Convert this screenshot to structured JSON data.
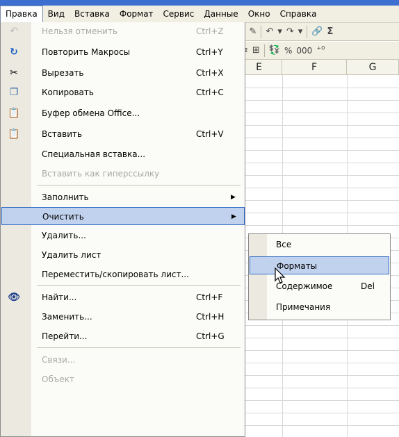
{
  "menubar": {
    "items": [
      {
        "label": "Правка"
      },
      {
        "label": "Вид"
      },
      {
        "label": "Вставка"
      },
      {
        "label": "Формат"
      },
      {
        "label": "Сервис"
      },
      {
        "label": "Данные"
      },
      {
        "label": "Окно"
      },
      {
        "label": "Справка"
      }
    ],
    "active": "Правка"
  },
  "toolbar": {
    "row1": {
      "sigma": "Σ"
    },
    "row2": {
      "percent": "%",
      "thousands": "000"
    }
  },
  "grid": {
    "columns": [
      "E",
      "F",
      "G"
    ]
  },
  "edit_menu": {
    "items": [
      {
        "id": "undo",
        "label": "Нельзя отменить",
        "shortcut": "Ctrl+Z",
        "disabled": true,
        "icon": "undo-icon"
      },
      {
        "id": "redo",
        "label": "Повторить Макросы",
        "shortcut": "Ctrl+Y",
        "disabled": false,
        "icon": "redo-icon"
      },
      {
        "id": "cut",
        "label": "Вырезать",
        "shortcut": "Ctrl+X",
        "disabled": false,
        "icon": "scissors-icon"
      },
      {
        "id": "copy",
        "label": "Копировать",
        "shortcut": "Ctrl+C",
        "disabled": false,
        "icon": "copy-icon"
      },
      {
        "id": "clipboard",
        "label": "Буфер обмена Office...",
        "shortcut": "",
        "disabled": false,
        "icon": "clipboard-icon"
      },
      {
        "id": "paste",
        "label": "Вставить",
        "shortcut": "Ctrl+V",
        "disabled": false,
        "icon": "paste-icon"
      },
      {
        "id": "paste-special",
        "label": "Специальная вставка...",
        "shortcut": "",
        "disabled": false,
        "icon": ""
      },
      {
        "id": "paste-hyperlink",
        "label": "Вставить как гиперссылку",
        "shortcut": "",
        "disabled": true,
        "icon": ""
      },
      {
        "id": "fill",
        "label": "Заполнить",
        "shortcut": "",
        "disabled": false,
        "icon": "",
        "submenu": true
      },
      {
        "id": "clear",
        "label": "Очистить",
        "shortcut": "",
        "disabled": false,
        "icon": "",
        "submenu": true,
        "highlighted": true
      },
      {
        "id": "delete",
        "label": "Удалить...",
        "shortcut": "",
        "disabled": false,
        "icon": ""
      },
      {
        "id": "delete-sheet",
        "label": "Удалить лист",
        "shortcut": "",
        "disabled": false,
        "icon": ""
      },
      {
        "id": "move-copy-sheet",
        "label": "Переместить/скопировать лист...",
        "shortcut": "",
        "disabled": false,
        "icon": ""
      },
      {
        "id": "find",
        "label": "Найти...",
        "shortcut": "Ctrl+F",
        "disabled": false,
        "icon": "binoculars-icon"
      },
      {
        "id": "replace",
        "label": "Заменить...",
        "shortcut": "Ctrl+H",
        "disabled": false,
        "icon": ""
      },
      {
        "id": "goto",
        "label": "Перейти...",
        "shortcut": "Ctrl+G",
        "disabled": false,
        "icon": ""
      },
      {
        "id": "links",
        "label": "Связи...",
        "shortcut": "",
        "disabled": true,
        "icon": ""
      },
      {
        "id": "object",
        "label": "Объект",
        "shortcut": "",
        "disabled": true,
        "icon": ""
      }
    ]
  },
  "clear_submenu": {
    "items": [
      {
        "id": "all",
        "label": "Все",
        "shortcut": ""
      },
      {
        "id": "formats",
        "label": "Форматы",
        "shortcut": "",
        "highlighted": true
      },
      {
        "id": "contents",
        "label": "Содержимое",
        "shortcut": "Del"
      },
      {
        "id": "comments",
        "label": "Примечания",
        "shortcut": ""
      }
    ]
  },
  "colors": {
    "highlight": "#c1d2ee",
    "highlight_border": "#316ac5",
    "menu_bg": "#fbfbf8",
    "icon_strip": "#ebe9e0",
    "disabled_text": "#a8a8a8"
  }
}
